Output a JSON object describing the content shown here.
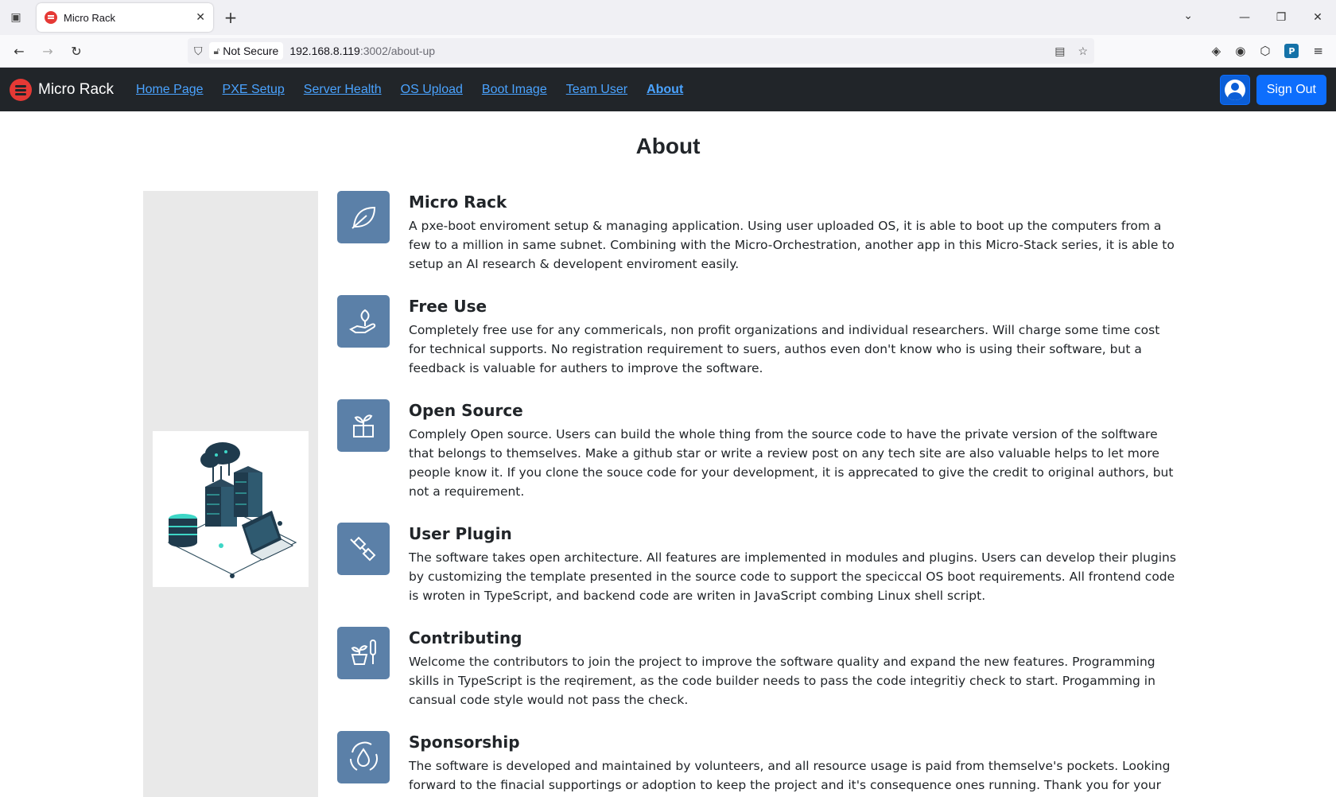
{
  "browser": {
    "tab_title": "Micro Rack",
    "url_security": "Not Secure",
    "url_host": "192.168.8.119",
    "url_rest": ":3002/about-up"
  },
  "nav": {
    "brand": "Micro Rack",
    "links": [
      "Home Page",
      "PXE Setup",
      "Server Health",
      "OS Upload",
      "Boot Image",
      "Team User",
      "About"
    ],
    "active": "About",
    "signout": "Sign Out"
  },
  "page": {
    "title": "About"
  },
  "features": [
    {
      "icon": "leaf-icon",
      "title": "Micro Rack",
      "text": "A pxe-boot enviroment setup & managing application. Using user uploaded OS, it is able to boot up the computers from a few to a million in same subnet. Combining with the Micro-Orchestration, another app in this Micro-Stack series, it is able to setup an AI research & developent enviroment easily."
    },
    {
      "icon": "hand-plant-icon",
      "title": "Free Use",
      "text": "Completely free use for any commericals, non profit organizations and individual researchers. Will charge some time cost for technical supports. No registration requirement to suers, authos even don't know who is using their software, but a feedback is valuable for authers to improve the software."
    },
    {
      "icon": "sprout-box-icon",
      "title": "Open Source",
      "text": "Complely Open source. Users can build the whole thing from the source code to have the private version of the solftware that belongs to themselves. Make a github star or write a review post on any tech site are also valuable helps to let more people know it. If you clone the souce code for your development, it is apprecated to give the credit to original authors, but not a requirement."
    },
    {
      "icon": "plug-icon",
      "title": "User Plugin",
      "text": "The software takes open architecture. All features are implemented in modules and plugins. Users can develop their plugins by customizing the template presented in the source code to support the speciccal OS boot requirements. All frontend code is wroten in TypeScript, and backend code are writen in JavaScript combing Linux shell script."
    },
    {
      "icon": "pot-trowel-icon",
      "title": "Contributing",
      "text": "Welcome the contributors to join the project to improve the software quality and expand the new features. Programming skills in TypeScript is the reqirement, as the code builder needs to pass the code integritiy check to start. Progamming in cansual code style would not pass the check."
    },
    {
      "icon": "recycle-drop-icon",
      "title": "Sponsorship",
      "text": "The software is developed and maintained by volunteers, and all resource usage is paid from themselve's pockets. Looking forward to the finacial supportings or adoption to keep the project and it's consequence ones running. Thank you for your time and attention to"
    }
  ]
}
